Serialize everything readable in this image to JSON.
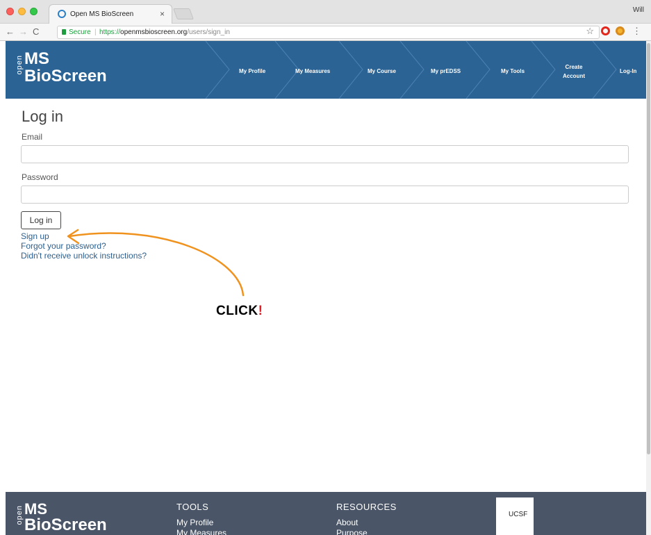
{
  "browser": {
    "tab_title": "Open MS BioScreen",
    "tab_close": "×",
    "profile": "Will",
    "secure_label": "Secure",
    "url_scheme": "https://",
    "url_host": "openmsbioscreen.org",
    "url_path": "/users/sign_in",
    "separator": "|"
  },
  "logo": {
    "open": "open",
    "ms": "MS",
    "bioscreen": "BioScreen"
  },
  "nav": {
    "items": [
      {
        "label": "My Profile"
      },
      {
        "label": "My Measures"
      },
      {
        "label": "My Course"
      },
      {
        "label": "My prEDSS"
      },
      {
        "label": "My Tools"
      },
      {
        "label": "Create Account"
      },
      {
        "label": "Log-In"
      }
    ]
  },
  "login": {
    "heading": "Log in",
    "email_label": "Email",
    "email_value": "",
    "password_label": "Password",
    "password_value": "",
    "submit_label": "Log in",
    "links": [
      {
        "label": "Sign up"
      },
      {
        "label": "Forgot your password?"
      },
      {
        "label": "Didn't receive unlock instructions?"
      }
    ]
  },
  "annotation": {
    "text": "CLICK",
    "bang": "!",
    "arrow_color": "#f0921e"
  },
  "footer": {
    "tools_heading": "TOOLS",
    "tools_items": [
      "My Profile",
      "My Measures"
    ],
    "resources_heading": "RESOURCES",
    "resources_items": [
      "About",
      "Purpose"
    ],
    "ucsf_logo": "UCSF"
  },
  "colors": {
    "header_bg": "#2b6395",
    "footer_bg": "#4a5567",
    "link": "#2b5f8e"
  }
}
